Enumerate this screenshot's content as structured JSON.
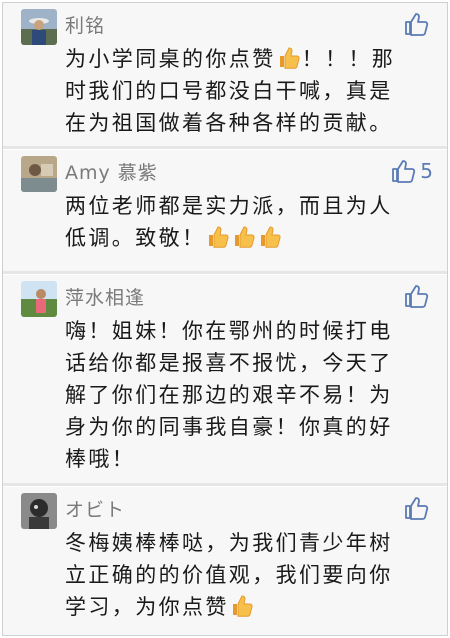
{
  "comments": [
    {
      "name": "利铭",
      "likes": "",
      "lines": [
        "为小学同桌的你点赞👍！！！那",
        "时我们的口号都没白干喊，真是",
        "在为祖国做着各种各样的贡献。"
      ]
    },
    {
      "name": "Amy 慕紫",
      "likes": "5",
      "lines": [
        "两位老师都是实力派，而且为人",
        "低调。致敬！👍👍👍"
      ]
    },
    {
      "name": "萍水相逢",
      "likes": "",
      "lines": [
        "嗨！姐妹！你在鄂州的时候打电",
        "话给你都是报喜不报忧，今天了",
        "解了你们在那边的艰辛不易！为",
        "身为你的同事我自豪！你真的好",
        "棒哦！"
      ]
    },
    {
      "name": "オビト",
      "likes": "",
      "lines": [
        "冬梅姨棒棒哒，为我们青少年树",
        "立正确的的价值观，我们要向你",
        "学习，为你点赞👍"
      ]
    }
  ],
  "colors": {
    "name": "#7a7a7a",
    "like": "#5b7bb4",
    "card_bg": "#f7f7f7",
    "text": "#1a1a1a"
  },
  "icons": {
    "like": "thumbs-up-outline-icon",
    "emoji": "thumbs-up-emoji-icon"
  }
}
